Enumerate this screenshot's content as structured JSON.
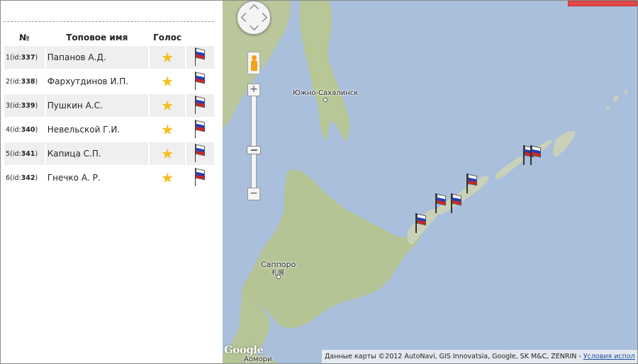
{
  "table": {
    "headers": {
      "num": "№",
      "name": "Топовое имя",
      "vote": "Голос"
    },
    "rows": [
      {
        "index": "1",
        "id_prefix": "(id:",
        "id": "337",
        "id_suffix": ")",
        "name": "Папанов А.Д.",
        "vote_icon": "star-icon",
        "flag_icon": "russian-flag-icon"
      },
      {
        "index": "2",
        "id_prefix": "(id:",
        "id": "338",
        "id_suffix": ")",
        "name": "Фархутдинов И.П.",
        "vote_icon": "star-icon",
        "flag_icon": "russian-flag-icon"
      },
      {
        "index": "3",
        "id_prefix": "(id:",
        "id": "339",
        "id_suffix": ")",
        "name": "Пушкин А.С.",
        "vote_icon": "star-icon",
        "flag_icon": "russian-flag-icon"
      },
      {
        "index": "4",
        "id_prefix": "(id:",
        "id": "340",
        "id_suffix": ")",
        "name": "Невельской Г.И.",
        "vote_icon": "star-icon",
        "flag_icon": "russian-flag-icon"
      },
      {
        "index": "5",
        "id_prefix": "(id:",
        "id": "341",
        "id_suffix": ")",
        "name": "Капица С.П.",
        "vote_icon": "star-icon",
        "flag_icon": "russian-flag-icon"
      },
      {
        "index": "6",
        "id_prefix": "(id:",
        "id": "342",
        "id_suffix": ")",
        "name": "Гнечко А. Р.",
        "vote_icon": "star-icon",
        "flag_icon": "russian-flag-icon"
      }
    ]
  },
  "map": {
    "labels": {
      "yuzhno": "Южно-Сахалинск",
      "sapporo": "Саппоро",
      "sapporo_jp": "札幌",
      "aomori": "Аомори"
    },
    "controls": {
      "zoom_in": "+",
      "zoom_out": "−",
      "pegman": "pegman-icon",
      "pan": "pan-control"
    },
    "logo": "Google",
    "attribution_text": "Данные карты ©2012 AutoNavi, GIS Innovatsia, Google, SK M&C, ZENRIN - ",
    "attribution_link": "Условия испол",
    "marker_icon": "russian-flag-icon",
    "marker_count": 6
  },
  "colors": {
    "sea": "#a9bfdc",
    "land": "#b9c79a",
    "row_stripe": "#efefef",
    "star": "#f1bf1f",
    "top_strip": "#e24848"
  }
}
